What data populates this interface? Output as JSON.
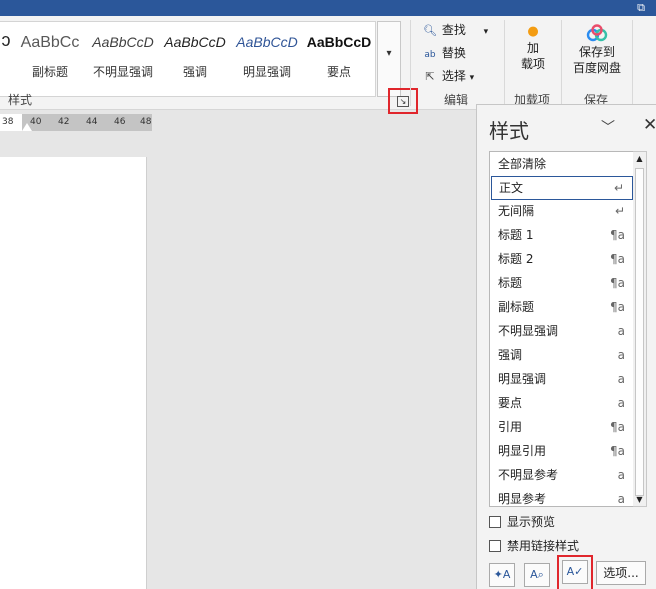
{
  "gallery": {
    "styles": [
      {
        "sample": "AaBbCc",
        "name": "副标题"
      },
      {
        "sample": "AaBbCcD",
        "name": "不明显强调"
      },
      {
        "sample": "AaBbCcD",
        "name": "强调"
      },
      {
        "sample": "AaBbCcD",
        "name": "明显强调"
      },
      {
        "sample": "AaBbCcD",
        "name": "要点"
      }
    ],
    "group_label": "样式"
  },
  "editing": {
    "find": "查找",
    "replace": "替换",
    "select": "选择",
    "group_label": "编辑"
  },
  "addins": {
    "button_line1": "加",
    "button_line2": "载项",
    "group_label": "加载项"
  },
  "save_cloud": {
    "button_line1": "保存到",
    "button_line2": "百度网盘",
    "group_label": "保存"
  },
  "ruler": {
    "numbers": [
      "38",
      "40",
      "42",
      "44",
      "46",
      "48"
    ]
  },
  "styles_pane": {
    "title": "样式",
    "items": [
      {
        "label": "全部清除",
        "symbol": ""
      },
      {
        "label": "正文",
        "symbol": "↵"
      },
      {
        "label": "无间隔",
        "symbol": "↵"
      },
      {
        "label": "标题 1",
        "symbol": "¶a"
      },
      {
        "label": "标题 2",
        "symbol": "¶a"
      },
      {
        "label": "标题",
        "symbol": "¶a"
      },
      {
        "label": "副标题",
        "symbol": "¶a"
      },
      {
        "label": "不明显强调",
        "symbol": "a"
      },
      {
        "label": "强调",
        "symbol": "a"
      },
      {
        "label": "明显强调",
        "symbol": "a"
      },
      {
        "label": "要点",
        "symbol": "a"
      },
      {
        "label": "引用",
        "symbol": "¶a"
      },
      {
        "label": "明显引用",
        "symbol": "¶a"
      },
      {
        "label": "不明显参考",
        "symbol": "a"
      },
      {
        "label": "明显参考",
        "symbol": "a"
      }
    ],
    "selected_index": 1,
    "show_preview": "显示预览",
    "disable_linked": "禁用链接样式",
    "options": "选项..."
  }
}
